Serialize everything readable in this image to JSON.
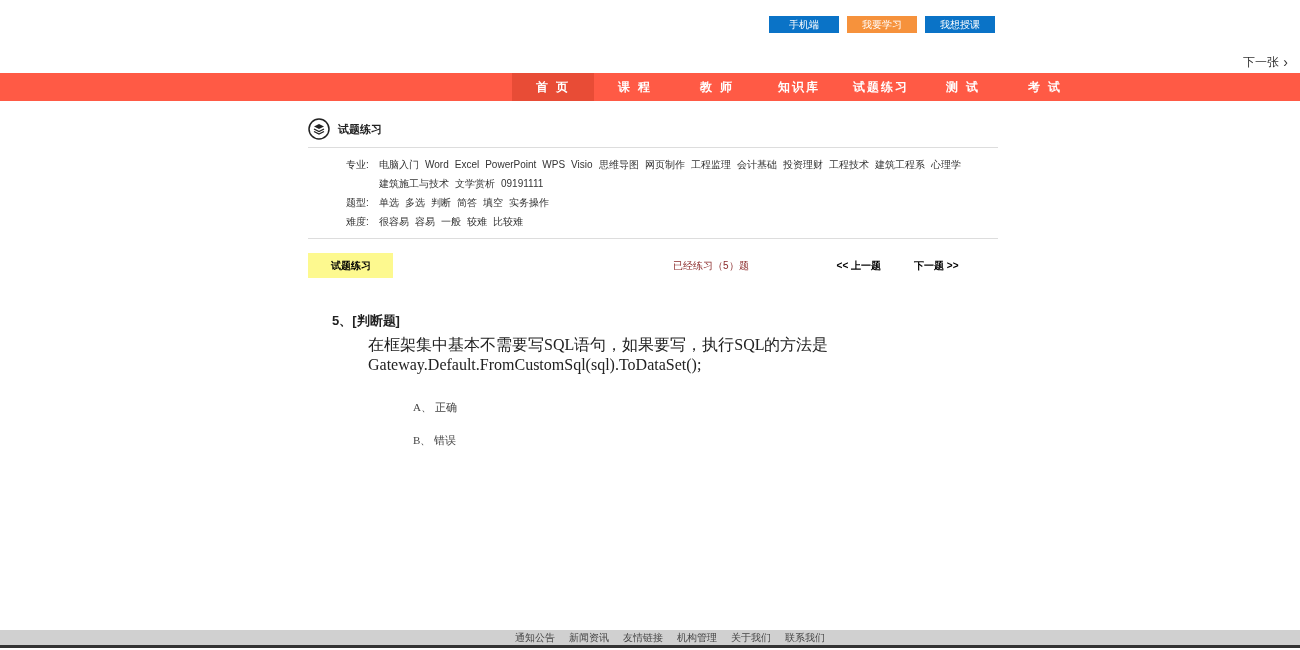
{
  "top_buttons": [
    {
      "label": "手机端",
      "color": "#0a73c7"
    },
    {
      "label": "我要学习",
      "color": "#f6923c"
    },
    {
      "label": "我想授课",
      "color": "#0a73c7"
    }
  ],
  "next_slide": {
    "label": "下一张",
    "icon": "›"
  },
  "nav": [
    {
      "label": "首 页",
      "selected": true
    },
    {
      "label": "课 程",
      "selected": false
    },
    {
      "label": "教 师",
      "selected": false
    },
    {
      "label": "知识库",
      "selected": false
    },
    {
      "label": "试题练习",
      "selected": false
    },
    {
      "label": "测 试",
      "selected": false
    },
    {
      "label": "考 试",
      "selected": false
    }
  ],
  "section_title": "试题练习",
  "filters": [
    {
      "label": "专业:",
      "options": [
        "电脑入门",
        "Word",
        "Excel",
        "PowerPoint",
        "WPS",
        "Visio",
        "思维导图",
        "网页制作",
        "工程监理",
        "会计基础",
        "投资理财",
        "工程技术",
        "建筑工程系",
        "心理学",
        "建筑施工与技术",
        "文学赏析",
        "09191111"
      ]
    },
    {
      "label": "题型:",
      "options": [
        "单选",
        "多选",
        "判断",
        "简答",
        "填空",
        "实务操作"
      ]
    },
    {
      "label": "难度:",
      "options": [
        "很容易",
        "容易",
        "一般",
        "较难",
        "比较难"
      ]
    }
  ],
  "practice_bar": {
    "tag": "试题练习",
    "progress": "已经练习（5）题",
    "prev": "<< 上一题",
    "next": "下一题 >>"
  },
  "question": {
    "heading": "5、[判断题]",
    "text": "在框架集中基本不需要写SQL语句，如果要写，执行SQL的方法是 Gateway.Default.FromCustomSql(sql).ToDataSet();",
    "options": [
      "A、 正确",
      "B、 错误"
    ]
  },
  "footer_links": [
    "通知公告",
    "新闻资讯",
    "友情链接",
    "机构管理",
    "关于我们",
    "联系我们"
  ]
}
